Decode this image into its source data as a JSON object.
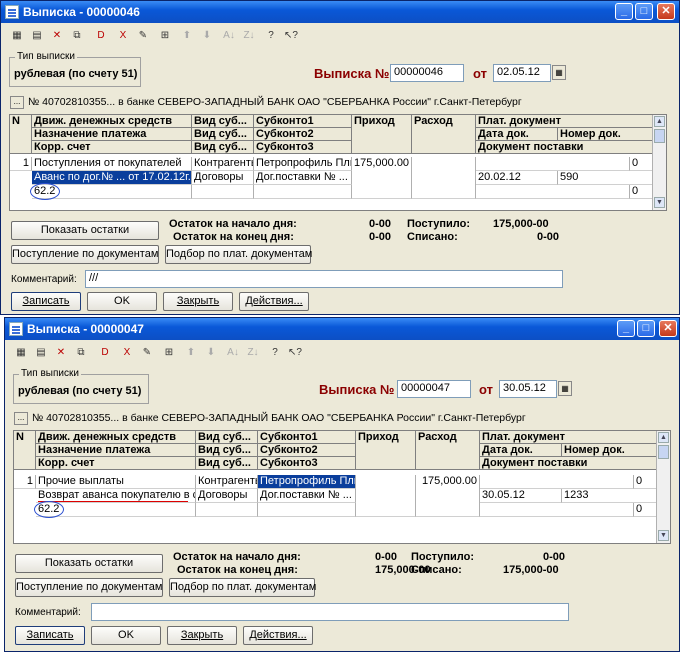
{
  "toolbar_icons": [
    "save-icon",
    "copy-icon",
    "delete-icon",
    "copy-row-icon",
    "doc-delete-icon",
    "doc-x-icon",
    "edit-icon",
    "insert-icon",
    "arrow-up-icon",
    "arrow-down-icon",
    "sort-asc-icon",
    "sort-desc-icon",
    "help-icon",
    "whatsthis-icon"
  ],
  "labels": {
    "type_group": "Тип выписки",
    "type_value": "рублевая (по счету 51)",
    "doc_label": "Выписка №",
    "date_from": "от",
    "opening_balance": "Остаток на начало дня:",
    "closing_balance": "Остаток на конец дня:",
    "received": "Поступило:",
    "spent": "Списано:",
    "comment": "Комментарий:"
  },
  "columns": {
    "n": "N",
    "c1": [
      "Движ. денежных средств",
      "Назначение платежа",
      "Корр. счет"
    ],
    "c2": [
      "Вид суб...",
      "Вид суб...",
      "Вид суб..."
    ],
    "c3": [
      "Субконто1",
      "Субконто2",
      "Субконто3"
    ],
    "income": "Приход",
    "expense": "Расход",
    "c6": "Плат. документ",
    "c6a": "Дата док.",
    "c6b": "Номер док.",
    "c6c": "Документ поставки"
  },
  "buttons": {
    "show_balance": "Показать остатки",
    "receipt_by_docs": "Поступление по документам",
    "select_by_docs": "Подбор по плат. документам",
    "write": "Записать",
    "ok": "OK",
    "close": "Закрыть",
    "actions": "Действия..."
  },
  "windows": [
    {
      "title": "Выписка - 00000046",
      "doc_number": "00000046",
      "doc_date": "02.05.12",
      "account": "№ 40702810355... в банке СЕВЕРО-ЗАПАДНЫЙ БАНК  ОАО \"СБЕРБАНКА России\" г.Санкт-Петербург",
      "row": {
        "n": "1",
        "flow": "Поступления от покупателей",
        "purpose": "Аванс по дог.№ ... от 17.02.12г.",
        "corr": "62.2",
        "kind1": "Контрагенты",
        "kind2": "Договоры",
        "sub1": "Петропрофиль Плюс",
        "sub2": "Дог.поставки № ... о",
        "income": "175,000.00",
        "expense": "",
        "pay_doc": "0",
        "doc_date": "20.02.12",
        "doc_num": "590",
        "supply_doc": "0"
      },
      "opening": "0-00",
      "closing": "0-00",
      "received": "175,000-00",
      "spent": "0-00",
      "comment": "///"
    },
    {
      "title": "Выписка - 00000047",
      "doc_number": "00000047",
      "doc_date": "30.05.12",
      "account": "№ 40702810355... в банке СЕВЕРО-ЗАПАДНЫЙ БАНК  ОАО \"СБЕРБАНКА России\" г.Санкт-Петербург",
      "row": {
        "n": "1",
        "flow": "Прочие выплаты",
        "purpose": "Возврат аванса покупателю в св",
        "corr": "62.2",
        "kind1": "Контрагенты",
        "kind2": "Договоры",
        "sub1": "Петропрофиль Плюс",
        "sub2": "Дог.поставки № ... о",
        "income": "",
        "expense": "175,000.00",
        "pay_doc": "0",
        "doc_date": "30.05.12",
        "doc_num": "1233",
        "supply_doc": "0"
      },
      "opening": "0-00",
      "closing": "175,000-00",
      "received": "0-00",
      "spent": "175,000-00",
      "comment": ""
    }
  ]
}
